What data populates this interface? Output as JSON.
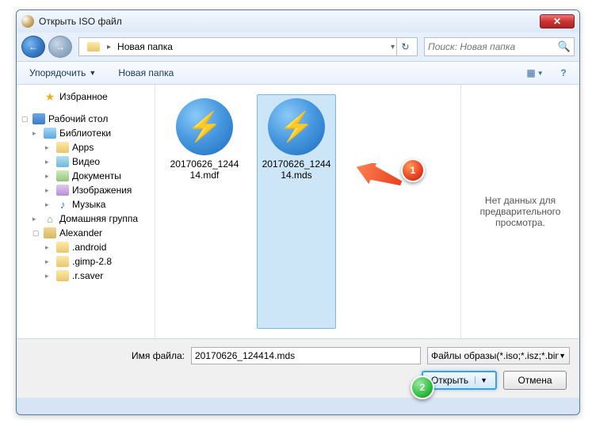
{
  "window": {
    "title": "Открыть ISO файл"
  },
  "breadcrumb": {
    "current": "Новая папка"
  },
  "search": {
    "placeholder": "Поиск: Новая папка"
  },
  "toolbar": {
    "organize": "Упорядочить",
    "newfolder": "Новая папка"
  },
  "tree": {
    "favorites": "Избранное",
    "desktop": "Рабочий стол",
    "libraries": "Библиотеки",
    "apps": "Apps",
    "video": "Видео",
    "documents": "Документы",
    "images": "Изображения",
    "music": "Музыка",
    "homegroup": "Домашняя группа",
    "user": "Alexander",
    "f1": ".android",
    "f2": ".gimp-2.8",
    "f3": ".r.saver"
  },
  "files": [
    {
      "name": "20170626_124414.mdf"
    },
    {
      "name": "20170626_124414.mds"
    }
  ],
  "preview": {
    "text": "Нет данных для предварительного просмотра."
  },
  "bottom": {
    "filename_label": "Имя файла:",
    "filename_value": "20170626_124414.mds",
    "filter": "Файлы образы(*.iso;*.isz;*.bin;",
    "open": "Открыть",
    "cancel": "Отмена"
  },
  "markers": {
    "m1": "1",
    "m2": "2"
  }
}
